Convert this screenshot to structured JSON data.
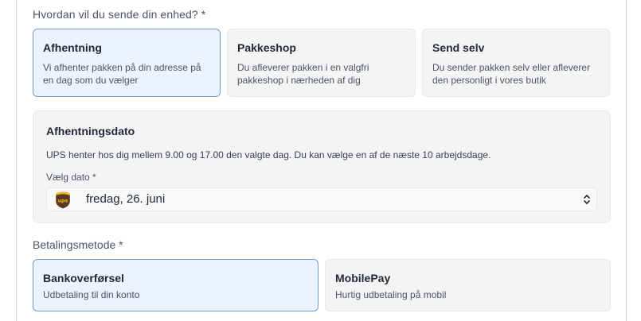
{
  "shipping": {
    "question": "Hvordan vil du sende din enhed? *",
    "options": [
      {
        "title": "Afhentning",
        "desc": "Vi afhenter pakken på din adresse på en dag som du vælger",
        "selected": true
      },
      {
        "title": "Pakkeshop",
        "desc": "Du afleverer pakken i en valgfri pakkeshop i nærheden af dig",
        "selected": false
      },
      {
        "title": "Send selv",
        "desc": "Du sender pakken selv eller afleverer den personligt i vores butik",
        "selected": false
      }
    ]
  },
  "pickup": {
    "title": "Afhentningsdato",
    "description": "UPS henter hos dig mellem 9.00 og 17.00 den valgte dag. Du kan vælge en af de næste 10 arbejdsdage.",
    "date_label": "Vælg dato *",
    "date_value": "fredag, 26. juni",
    "carrier_icon": "ups-logo-icon"
  },
  "payment": {
    "question": "Betalingsmetode *",
    "options": [
      {
        "title": "Bankoverførsel",
        "desc": "Udbetaling til din konto",
        "selected": true
      },
      {
        "title": "MobilePay",
        "desc": "Hurtig udbetaling på mobil",
        "selected": false
      }
    ]
  },
  "colors": {
    "selected_bg": "#eaf3fe",
    "selected_border": "#6b9ce0",
    "card_bg": "#f4f4f5",
    "ups_brown": "#5a3a1b",
    "ups_gold": "#f3b821"
  }
}
